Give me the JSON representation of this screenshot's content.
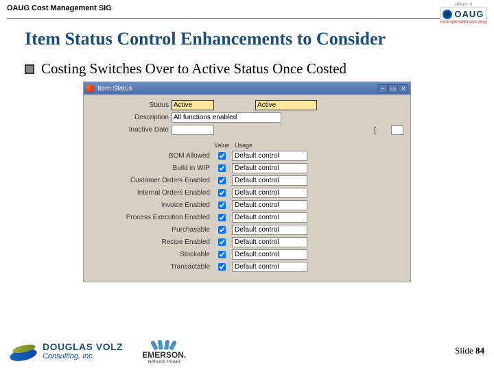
{
  "header": {
    "sig": "OAUG Cost Management SIG"
  },
  "logo_top": {
    "affil": "affiliate of",
    "text": "OAUG",
    "sub": "oracle applications users group"
  },
  "title": "Item Status Control Enhancements to Consider",
  "bullet": "Costing Switches Over to Active Status Once Costed",
  "window": {
    "title": "Item Status",
    "labels": {
      "status": "Status",
      "desc": "Description",
      "inactive": "Inactive Date",
      "value": "Value",
      "usage": "Usage"
    },
    "status_val": "Active",
    "status_val2": "Active",
    "desc_val": "All functions enabled",
    "bracket": "[",
    "rows": [
      {
        "label": "BOM Allowed",
        "checked": true,
        "usage": "Default control"
      },
      {
        "label": "Build in WIP",
        "checked": true,
        "usage": "Default control"
      },
      {
        "label": "Customer Orders Enabled",
        "checked": true,
        "usage": "Default control"
      },
      {
        "label": "Internal Orders Enabled",
        "checked": true,
        "usage": "Default control"
      },
      {
        "label": "Invoice Enabled",
        "checked": true,
        "usage": "Default control"
      },
      {
        "label": "Process Execution Enabled",
        "checked": true,
        "usage": "Default control"
      },
      {
        "label": "Purchasable",
        "checked": true,
        "usage": "Default control"
      },
      {
        "label": "Recipe Enabled",
        "checked": true,
        "usage": "Default control"
      },
      {
        "label": "Stockable",
        "checked": true,
        "usage": "Default control"
      },
      {
        "label": "Transactable",
        "checked": true,
        "usage": "Default control"
      }
    ]
  },
  "footer": {
    "dv_name": "DOUGLAS VOLZ",
    "dv_sub": "Consulting, Inc.",
    "em_name": "EMERSON.",
    "em_sub": "Network Power",
    "slide_label": "Slide ",
    "slide_num": "84"
  }
}
